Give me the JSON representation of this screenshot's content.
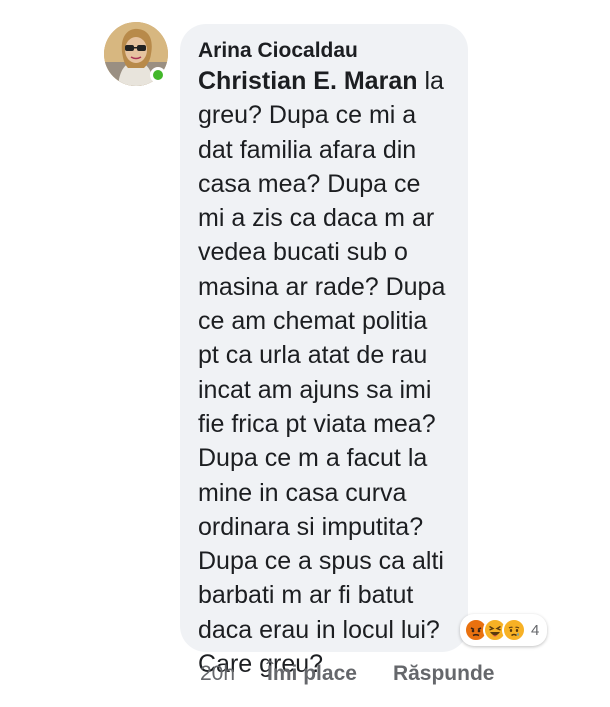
{
  "comment": {
    "author": "Arina Ciocaldau",
    "mention": "Christian E. Maran",
    "text": " la greu? Dupa ce mi a dat familia afara din casa mea? Dupa ce mi a zis ca daca m ar vedea bucati sub o masina ar rade? Dupa ce am chemat politia pt ca urla atat de rau incat am ajuns sa imi fie frica pt viata mea? Dupa ce m a facut la mine in casa curva ordinara si imputita? Dupa ce a spus ca alti barbati m ar fi batut daca erau in locul lui? Care greu?",
    "online": true
  },
  "reactions": {
    "icons": [
      "angry-icon",
      "haha-icon",
      "sad-icon"
    ],
    "colors": {
      "angry": "#e9710f",
      "haha": "#f7b125",
      "sad": "#f7b125"
    },
    "count": "4"
  },
  "actions": {
    "time": "20h",
    "like_label": "Îmi place",
    "reply_label": "Răspunde"
  }
}
